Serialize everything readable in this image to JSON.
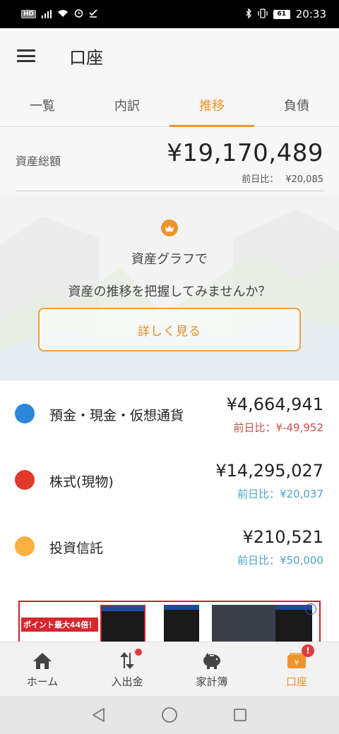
{
  "status_bar": {
    "left_badge": "HD",
    "time": "20:33",
    "battery": "61"
  },
  "app_bar": {
    "title": "口座"
  },
  "tabs": [
    {
      "label": "一覧",
      "active": false
    },
    {
      "label": "内訳",
      "active": false
    },
    {
      "label": "推移",
      "active": true
    },
    {
      "label": "負債",
      "active": false
    }
  ],
  "summary": {
    "label": "資産総額",
    "total": "¥19,170,489",
    "diff_label": "前日比：",
    "diff_value": "¥20,085"
  },
  "promo": {
    "line1": "資産グラフで",
    "line2": "資産の推移を把握してみませんか？",
    "button": "詳しく見る"
  },
  "assets": [
    {
      "name": "預金・現金・仮想通貨",
      "amount": "¥4,664,941",
      "diff": "前日比：¥-49,952",
      "color": "#2e86d9",
      "trend": "neg"
    },
    {
      "name": "株式(現物)",
      "amount": "¥14,295,027",
      "diff": "前日比：¥20,037",
      "color": "#e2372b",
      "trend": "pos"
    },
    {
      "name": "投資信託",
      "amount": "¥210,521",
      "diff": "前日比：¥50,000",
      "color": "#fbb040",
      "trend": "pos"
    }
  ],
  "ad": {
    "text": "ポイント最大44倍！"
  },
  "bottom_nav": [
    {
      "label": "ホーム",
      "icon": "home-icon"
    },
    {
      "label": "入出金",
      "icon": "transfer-icon"
    },
    {
      "label": "家計簿",
      "icon": "piggy-bank-icon"
    },
    {
      "label": "口座",
      "icon": "wallet-icon"
    }
  ],
  "colors": {
    "accent": "#f0932b",
    "negative": "#c0504d",
    "positive": "#4aa3c7"
  }
}
